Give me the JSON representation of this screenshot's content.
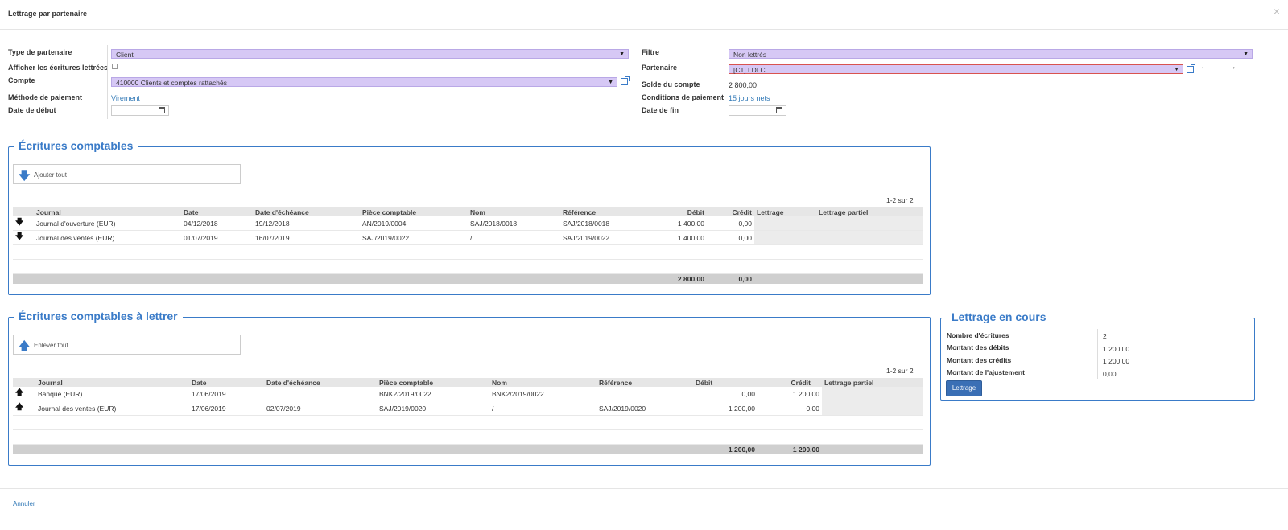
{
  "modal": {
    "title": "Lettrage par partenaire",
    "close": "×"
  },
  "form": {
    "left": {
      "partner_type_label": "Type de partenaire",
      "partner_type_value": "Client",
      "show_reconciled_label": "Afficher les écritures lettrées",
      "account_label": "Compte",
      "account_value": "410000 Clients et comptes rattachés",
      "payment_method_label": "Méthode de paiement",
      "payment_method_value": "Virement",
      "start_date_label": "Date de début"
    },
    "right": {
      "filter_label": "Filtre",
      "filter_value": "Non lettrés",
      "partner_label": "Partenaire",
      "partner_value": "[C1] LDLC",
      "balance_label": "Solde du compte",
      "balance_value": "2 800,00",
      "payment_terms_label": "Conditions de paiement",
      "payment_terms_value": "15 jours nets",
      "end_date_label": "Date de fin",
      "prev_arrow": "🡐",
      "next_arrow": "🡒"
    }
  },
  "entries": {
    "title": "Écritures comptables",
    "add_all": "Ajouter tout",
    "pager": "1-2 sur 2",
    "columns": [
      "Journal",
      "Date",
      "Date d'échéance",
      "Pièce comptable",
      "Nom",
      "Référence",
      "Débit",
      "Crédit",
      "Lettrage",
      "Lettrage partiel"
    ],
    "rows": [
      {
        "journal": "Journal d'ouverture (EUR)",
        "date": "04/12/2018",
        "due": "19/12/2018",
        "piece": "AN/2019/0004",
        "nom": "SAJ/2018/0018",
        "ref": "SAJ/2018/0018",
        "debit": "1 400,00",
        "credit": "0,00"
      },
      {
        "journal": "Journal des ventes (EUR)",
        "date": "01/07/2019",
        "due": "16/07/2019",
        "piece": "SAJ/2019/0022",
        "nom": "/",
        "ref": "SAJ/2019/0022",
        "debit": "1 400,00",
        "credit": "0,00"
      }
    ],
    "total_debit": "2 800,00",
    "total_credit": "0,00"
  },
  "to_reconcile": {
    "title": "Écritures comptables à lettrer",
    "remove_all": "Enlever tout",
    "pager": "1-2 sur 2",
    "columns": [
      "Journal",
      "Date",
      "Date d'échéance",
      "Pièce comptable",
      "Nom",
      "Référence",
      "Débit",
      "Crédit",
      "Lettrage partiel"
    ],
    "rows": [
      {
        "journal": "Banque (EUR)",
        "date": "17/06/2019",
        "due": "",
        "piece": "BNK2/2019/0022",
        "nom": "BNK2/2019/0022",
        "ref": "",
        "debit": "0,00",
        "credit": "1 200,00"
      },
      {
        "journal": "Journal des ventes (EUR)",
        "date": "17/06/2019",
        "due": "02/07/2019",
        "piece": "SAJ/2019/0020",
        "nom": "/",
        "ref": "SAJ/2019/0020",
        "debit": "1 200,00",
        "credit": "0,00"
      }
    ],
    "total_debit": "1 200,00",
    "total_credit": "1 200,00"
  },
  "in_progress": {
    "title": "Lettrage en cours",
    "count_label": "Nombre d'écritures",
    "count_value": "2",
    "debit_label": "Montant des débits",
    "debit_value": "1 200,00",
    "credit_label": "Montant des crédits",
    "credit_value": "1 200,00",
    "adjust_label": "Montant de l'ajustement",
    "adjust_value": "0,00",
    "button": "Lettrage"
  },
  "footer": {
    "cancel": "Annuler"
  },
  "colors": {
    "accent": "#3a7bc8",
    "select_bg": "#d6c8f5",
    "primary_btn": "#3a6fb5"
  }
}
